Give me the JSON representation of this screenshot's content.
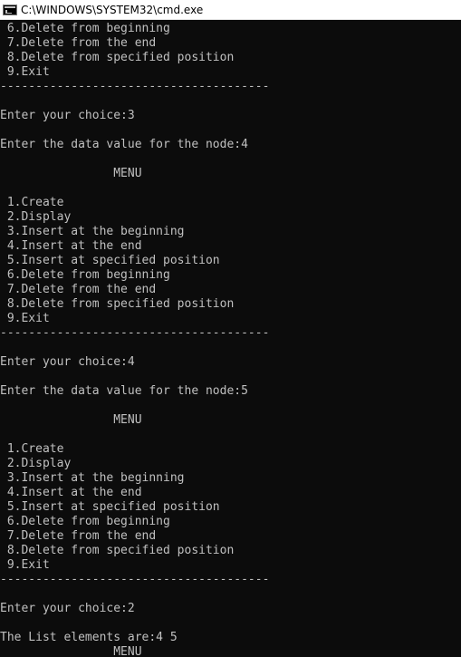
{
  "window": {
    "title": "C:\\WINDOWS\\SYSTEM32\\cmd.exe",
    "icon": "console-icon"
  },
  "console": {
    "lines": [
      " 6.Delete from beginning",
      " 7.Delete from the end",
      " 8.Delete from specified position",
      " 9.Exit",
      "--------------------------------------",
      "",
      "Enter your choice:3",
      "",
      "Enter the data value for the node:4",
      "",
      "                MENU",
      "",
      " 1.Create",
      " 2.Display",
      " 3.Insert at the beginning",
      " 4.Insert at the end",
      " 5.Insert at specified position",
      " 6.Delete from beginning",
      " 7.Delete from the end",
      " 8.Delete from specified position",
      " 9.Exit",
      "--------------------------------------",
      "",
      "Enter your choice:4",
      "",
      "Enter the data value for the node:5",
      "",
      "                MENU",
      "",
      " 1.Create",
      " 2.Display",
      " 3.Insert at the beginning",
      " 4.Insert at the end",
      " 5.Insert at specified position",
      " 6.Delete from beginning",
      " 7.Delete from the end",
      " 8.Delete from specified position",
      " 9.Exit",
      "--------------------------------------",
      "",
      "Enter your choice:2",
      "",
      "The List elements are:4 5",
      "                MENU"
    ]
  }
}
